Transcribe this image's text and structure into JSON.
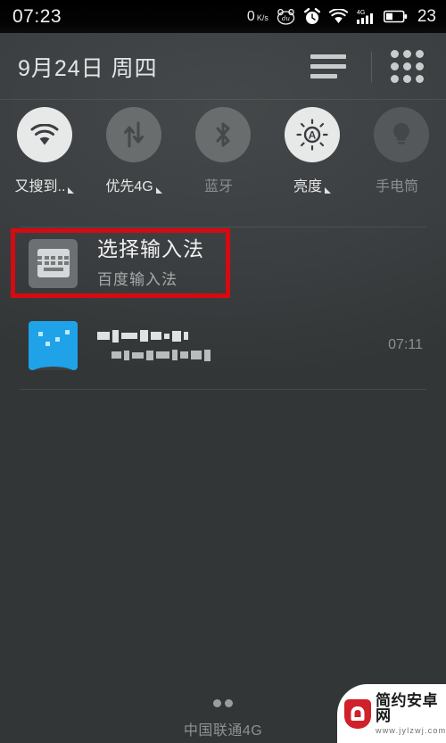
{
  "statusbar": {
    "clock": "07:23",
    "net_speed": "0",
    "net_unit_top": "K",
    "net_unit_bottom": "s",
    "battery_percent": "23",
    "icons": [
      "baidu-bear-icon",
      "alarm-clock-icon",
      "wifi-icon",
      "signal-4g-icon",
      "battery-icon"
    ]
  },
  "header": {
    "date": "9月24日  周四",
    "menu_icon": "hamburger-icon",
    "grid_icon": "app-grid-icon"
  },
  "toggles": [
    {
      "label": "又搜到..",
      "icon": "wifi-icon",
      "state": "on",
      "expandable": true
    },
    {
      "label": "优先4G",
      "icon": "mobile-data-icon",
      "state": "off",
      "expandable": true
    },
    {
      "label": "蓝牙",
      "icon": "bluetooth-icon",
      "state": "off",
      "expandable": false
    },
    {
      "label": "亮度",
      "icon": "brightness-auto-icon",
      "state": "on",
      "expandable": true
    },
    {
      "label": "手电筒",
      "icon": "flashlight-icon",
      "state": "dim",
      "expandable": false
    }
  ],
  "notifications": [
    {
      "icon": "keyboard-icon",
      "title": "选择输入法",
      "subtitle": "百度输入法",
      "time": "",
      "highlighted": true
    },
    {
      "icon": "blue-app-icon",
      "title": "",
      "subtitle": "",
      "time": "07:11",
      "redacted": true
    }
  ],
  "annotation": {
    "shape": "rectangle",
    "color": "#d60a11"
  },
  "footer": {
    "carrier": "中国联通4G"
  },
  "watermark": {
    "site_name": "简约安卓网",
    "url": "www.jylzwj.com",
    "logo": "android-shield-icon"
  }
}
